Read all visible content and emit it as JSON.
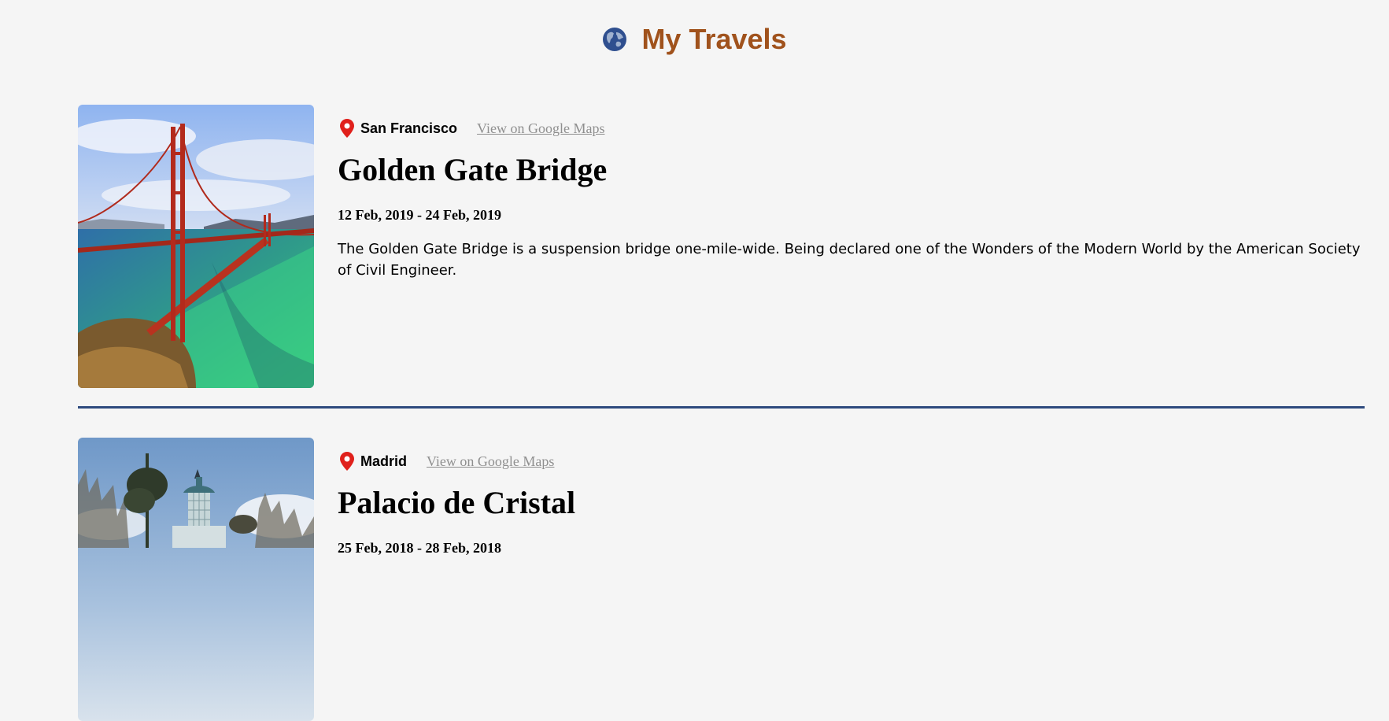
{
  "header": {
    "title": "My Travels",
    "icon": "globe-icon"
  },
  "entries": [
    {
      "location": "San Francisco",
      "maps_link": "View on Google Maps",
      "title": "Golden Gate Bridge",
      "dates": "12 Feb, 2019 - 24 Feb, 2019",
      "description": "The Golden Gate Bridge is a suspension bridge one-mile-wide. Being declared one of the Wonders of the Modern World by the American Society of Civil Engineer.",
      "image": "golden-gate-bridge-photo"
    },
    {
      "location": "Madrid",
      "maps_link": "View on Google Maps",
      "title": "Palacio de Cristal",
      "dates": "25 Feb, 2018 - 28 Feb, 2018",
      "image": "palacio-de-cristal-photo"
    }
  ],
  "colors": {
    "title": "#a0521c",
    "divider": "#2e4a7e",
    "pin": "#e0201b",
    "link": "#8f8f8f",
    "background": "#f5f5f5"
  }
}
